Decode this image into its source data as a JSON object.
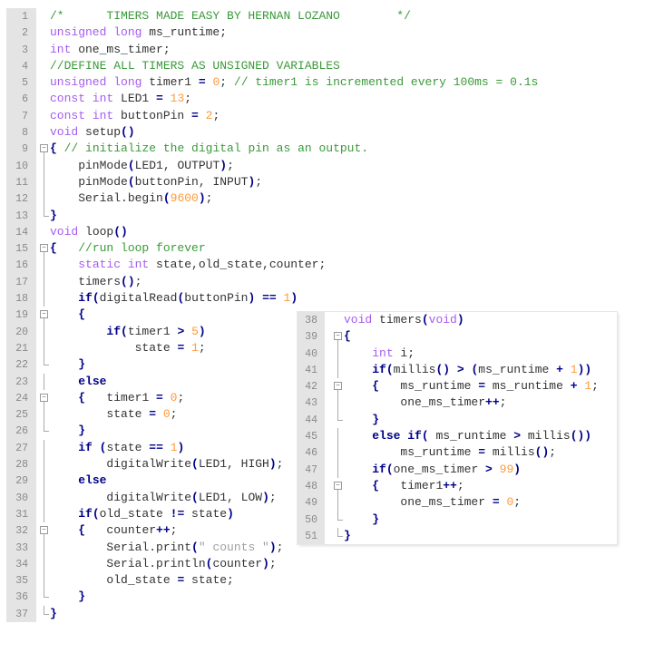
{
  "colors": {
    "keyword": "#a55cf0",
    "comment": "#3a9a3a",
    "number": "#ff9a3c",
    "operator": "#00008a",
    "string": "#a0a0a0",
    "text": "#333333",
    "gutter": "#e4e4e4"
  },
  "left_editor": {
    "first_line": 1,
    "fold_start": [
      9,
      15,
      19,
      24,
      32
    ],
    "fold_end": [
      13,
      22,
      26,
      36,
      37
    ],
    "fold_bar": [
      10,
      11,
      12,
      16,
      17,
      18,
      20,
      21,
      23,
      25,
      27,
      28,
      29,
      30,
      31,
      33,
      34,
      35
    ],
    "lines": [
      [
        [
          "c",
          "/*      TIMERS MADE EASY BY HERNAN LOZANO        */"
        ]
      ],
      [
        [
          "k",
          "unsigned long"
        ],
        [
          "t",
          " ms_runtime;"
        ]
      ],
      [
        [
          "k",
          "int"
        ],
        [
          "t",
          " one_ms_timer;"
        ]
      ],
      [
        [
          "c",
          "//DEFINE ALL TIMERS AS UNSIGNED VARIABLES"
        ]
      ],
      [
        [
          "k",
          "unsigned long"
        ],
        [
          "t",
          " timer1 "
        ],
        [
          "o",
          "="
        ],
        [
          "t",
          " "
        ],
        [
          "n",
          "0"
        ],
        [
          "t",
          "; "
        ],
        [
          "c",
          "// timer1 is incremented every 100ms = 0.1s"
        ]
      ],
      [
        [
          "k",
          "const int"
        ],
        [
          "t",
          " LED1 "
        ],
        [
          "o",
          "="
        ],
        [
          "t",
          " "
        ],
        [
          "n",
          "13"
        ],
        [
          "t",
          ";"
        ]
      ],
      [
        [
          "k",
          "const int"
        ],
        [
          "t",
          " buttonPin "
        ],
        [
          "o",
          "="
        ],
        [
          "t",
          " "
        ],
        [
          "n",
          "2"
        ],
        [
          "t",
          ";"
        ]
      ],
      [
        [
          "k",
          "void"
        ],
        [
          "t",
          " setup"
        ],
        [
          "o",
          "()"
        ]
      ],
      [
        [
          "o",
          "{"
        ],
        [
          "t",
          " "
        ],
        [
          "c",
          "// initialize the digital pin as an output."
        ]
      ],
      [
        [
          "t",
          "    pinMode"
        ],
        [
          "o",
          "("
        ],
        [
          "t",
          "LED1, OUTPUT"
        ],
        [
          "o",
          ")"
        ],
        [
          "t",
          ";"
        ]
      ],
      [
        [
          "t",
          "    pinMode"
        ],
        [
          "o",
          "("
        ],
        [
          "t",
          "buttonPin, INPUT"
        ],
        [
          "o",
          ")"
        ],
        [
          "t",
          ";"
        ]
      ],
      [
        [
          "t",
          "    Serial.begin"
        ],
        [
          "o",
          "("
        ],
        [
          "n",
          "9600"
        ],
        [
          "o",
          ")"
        ],
        [
          "t",
          ";"
        ]
      ],
      [
        [
          "o",
          "}"
        ]
      ],
      [
        [
          "k",
          "void"
        ],
        [
          "t",
          " loop"
        ],
        [
          "o",
          "()"
        ]
      ],
      [
        [
          "o",
          "{"
        ],
        [
          "t",
          "   "
        ],
        [
          "c",
          "//run loop forever"
        ]
      ],
      [
        [
          "t",
          "    "
        ],
        [
          "k",
          "static int"
        ],
        [
          "t",
          " state,old_state,counter;"
        ]
      ],
      [
        [
          "t",
          "    timers"
        ],
        [
          "o",
          "()"
        ],
        [
          "t",
          ";"
        ]
      ],
      [
        [
          "t",
          "    "
        ],
        [
          "o",
          "if("
        ],
        [
          "t",
          "digitalRead"
        ],
        [
          "o",
          "("
        ],
        [
          "t",
          "buttonPin"
        ],
        [
          "o",
          ")"
        ],
        [
          "t",
          " "
        ],
        [
          "o",
          "=="
        ],
        [
          "t",
          " "
        ],
        [
          "n",
          "1"
        ],
        [
          "o",
          ")"
        ]
      ],
      [
        [
          "t",
          "    "
        ],
        [
          "o",
          "{"
        ]
      ],
      [
        [
          "t",
          "        "
        ],
        [
          "o",
          "if("
        ],
        [
          "t",
          "timer1 "
        ],
        [
          "o",
          ">"
        ],
        [
          "t",
          " "
        ],
        [
          "n",
          "5"
        ],
        [
          "o",
          ")"
        ]
      ],
      [
        [
          "t",
          "            state "
        ],
        [
          "o",
          "="
        ],
        [
          "t",
          " "
        ],
        [
          "n",
          "1"
        ],
        [
          "t",
          ";"
        ]
      ],
      [
        [
          "t",
          "    "
        ],
        [
          "o",
          "}"
        ]
      ],
      [
        [
          "t",
          "    "
        ],
        [
          "o",
          "else"
        ]
      ],
      [
        [
          "t",
          "    "
        ],
        [
          "o",
          "{"
        ],
        [
          "t",
          "   timer1 "
        ],
        [
          "o",
          "="
        ],
        [
          "t",
          " "
        ],
        [
          "n",
          "0"
        ],
        [
          "t",
          ";"
        ]
      ],
      [
        [
          "t",
          "        state "
        ],
        [
          "o",
          "="
        ],
        [
          "t",
          " "
        ],
        [
          "n",
          "0"
        ],
        [
          "t",
          ";"
        ]
      ],
      [
        [
          "t",
          "    "
        ],
        [
          "o",
          "}"
        ]
      ],
      [
        [
          "t",
          "    "
        ],
        [
          "o",
          "if"
        ],
        [
          "t",
          " "
        ],
        [
          "o",
          "("
        ],
        [
          "t",
          "state "
        ],
        [
          "o",
          "=="
        ],
        [
          "t",
          " "
        ],
        [
          "n",
          "1"
        ],
        [
          "o",
          ")"
        ]
      ],
      [
        [
          "t",
          "        digitalWrite"
        ],
        [
          "o",
          "("
        ],
        [
          "t",
          "LED1, HIGH"
        ],
        [
          "o",
          ")"
        ],
        [
          "t",
          ";"
        ]
      ],
      [
        [
          "t",
          "    "
        ],
        [
          "o",
          "else"
        ]
      ],
      [
        [
          "t",
          "        digitalWrite"
        ],
        [
          "o",
          "("
        ],
        [
          "t",
          "LED1, LOW"
        ],
        [
          "o",
          ")"
        ],
        [
          "t",
          ";"
        ]
      ],
      [
        [
          "t",
          "    "
        ],
        [
          "o",
          "if("
        ],
        [
          "t",
          "old_state "
        ],
        [
          "o",
          "!="
        ],
        [
          "t",
          " state"
        ],
        [
          "o",
          ")"
        ]
      ],
      [
        [
          "t",
          "    "
        ],
        [
          "o",
          "{"
        ],
        [
          "t",
          "   counter"
        ],
        [
          "o",
          "++"
        ],
        [
          "t",
          ";"
        ]
      ],
      [
        [
          "t",
          "        Serial.print"
        ],
        [
          "o",
          "("
        ],
        [
          "s",
          "\" counts \""
        ],
        [
          "o",
          ")"
        ],
        [
          "t",
          ";"
        ]
      ],
      [
        [
          "t",
          "        Serial.println"
        ],
        [
          "o",
          "("
        ],
        [
          "t",
          "counter"
        ],
        [
          "o",
          ")"
        ],
        [
          "t",
          ";"
        ]
      ],
      [
        [
          "t",
          "        old_state "
        ],
        [
          "o",
          "="
        ],
        [
          "t",
          " state;"
        ]
      ],
      [
        [
          "t",
          "    "
        ],
        [
          "o",
          "}"
        ]
      ],
      [
        [
          "o",
          "}"
        ]
      ]
    ]
  },
  "right_editor": {
    "first_line": 38,
    "fold_start": [
      39,
      42,
      48
    ],
    "fold_end": [
      44,
      50,
      51
    ],
    "fold_bar": [
      40,
      41,
      43,
      45,
      46,
      47,
      49
    ],
    "lines": [
      [
        [
          "k",
          "void"
        ],
        [
          "t",
          " timers"
        ],
        [
          "o",
          "("
        ],
        [
          "k",
          "void"
        ],
        [
          "o",
          ")"
        ]
      ],
      [
        [
          "o",
          "{"
        ]
      ],
      [
        [
          "t",
          "    "
        ],
        [
          "k",
          "int"
        ],
        [
          "t",
          " i;"
        ]
      ],
      [
        [
          "t",
          "    "
        ],
        [
          "o",
          "if("
        ],
        [
          "t",
          "millis"
        ],
        [
          "o",
          "()"
        ],
        [
          "t",
          " "
        ],
        [
          "o",
          ">"
        ],
        [
          "t",
          " "
        ],
        [
          "o",
          "("
        ],
        [
          "t",
          "ms_runtime "
        ],
        [
          "o",
          "+"
        ],
        [
          "t",
          " "
        ],
        [
          "n",
          "1"
        ],
        [
          "o",
          "))"
        ]
      ],
      [
        [
          "t",
          "    "
        ],
        [
          "o",
          "{"
        ],
        [
          "t",
          "   ms_runtime "
        ],
        [
          "o",
          "="
        ],
        [
          "t",
          " ms_runtime "
        ],
        [
          "o",
          "+"
        ],
        [
          "t",
          " "
        ],
        [
          "n",
          "1"
        ],
        [
          "t",
          ";"
        ]
      ],
      [
        [
          "t",
          "        one_ms_timer"
        ],
        [
          "o",
          "++"
        ],
        [
          "t",
          ";"
        ]
      ],
      [
        [
          "t",
          "    "
        ],
        [
          "o",
          "}"
        ]
      ],
      [
        [
          "t",
          "    "
        ],
        [
          "o",
          "else if("
        ],
        [
          "t",
          " ms_runtime "
        ],
        [
          "o",
          ">"
        ],
        [
          "t",
          " millis"
        ],
        [
          "o",
          "())"
        ]
      ],
      [
        [
          "t",
          "        ms_runtime "
        ],
        [
          "o",
          "="
        ],
        [
          "t",
          " millis"
        ],
        [
          "o",
          "()"
        ],
        [
          "t",
          ";"
        ]
      ],
      [
        [
          "t",
          "    "
        ],
        [
          "o",
          "if("
        ],
        [
          "t",
          "one_ms_timer "
        ],
        [
          "o",
          ">"
        ],
        [
          "t",
          " "
        ],
        [
          "n",
          "99"
        ],
        [
          "o",
          ")"
        ]
      ],
      [
        [
          "t",
          "    "
        ],
        [
          "o",
          "{"
        ],
        [
          "t",
          "   timer1"
        ],
        [
          "o",
          "++"
        ],
        [
          "t",
          ";"
        ]
      ],
      [
        [
          "t",
          "        one_ms_timer "
        ],
        [
          "o",
          "="
        ],
        [
          "t",
          " "
        ],
        [
          "n",
          "0"
        ],
        [
          "t",
          ";"
        ]
      ],
      [
        [
          "t",
          "    "
        ],
        [
          "o",
          "}"
        ]
      ],
      [
        [
          "o",
          "}"
        ]
      ]
    ]
  }
}
